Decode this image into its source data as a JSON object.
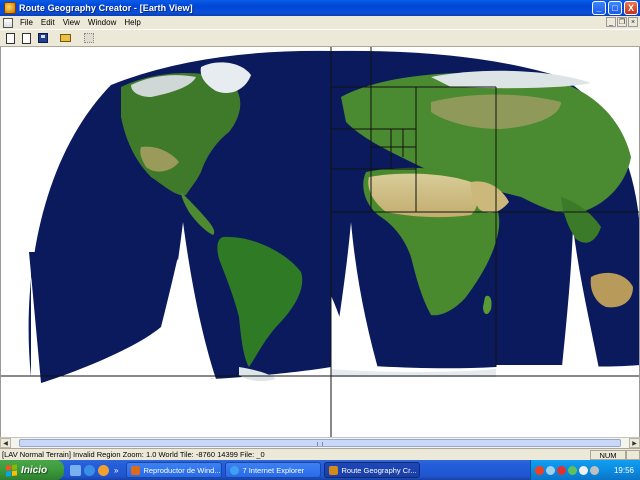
{
  "window": {
    "title": "Route Geography Creator - [Earth View]",
    "minimize": "_",
    "maximize": "□",
    "close": "X"
  },
  "menu": {
    "items": [
      "File",
      "Edit",
      "View",
      "Window",
      "Help"
    ],
    "mdi_minimize": "_",
    "mdi_restore": "❐",
    "mdi_close": "×"
  },
  "toolbar": {
    "icons": [
      "new-document-icon",
      "new-route-icon",
      "save-icon",
      "open-folder-icon",
      "layers-icon"
    ]
  },
  "status": {
    "text": "[LAV Normal Terrain]  Invalid Region  Zoom: 1.0   World Tile: -8760 14399  File: _0",
    "num": "NUM"
  },
  "taskbar": {
    "start_label": "Inicio",
    "quick_more": "»",
    "tasks": [
      {
        "label": "Reproductor de Wind...",
        "icon_color": "#e06a1a"
      },
      {
        "label": "7 Internet Explorer",
        "icon_color": "#3fa0f0"
      },
      {
        "label": "Route Geography Cr...",
        "icon_color": "#d28a1a"
      }
    ],
    "clock": "19:56"
  },
  "colors": {
    "ocean": "#0a1a5c",
    "land_green": "#3f8a2e",
    "desert": "#cfc08a",
    "ice": "#e8edf0",
    "titlebar": "#0a4fd8",
    "chrome": "#ece9d8"
  }
}
